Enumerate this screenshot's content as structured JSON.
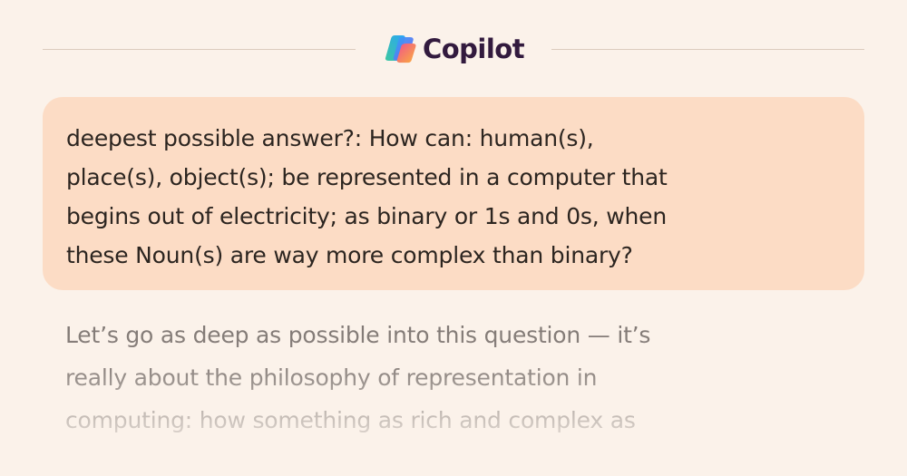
{
  "header": {
    "brand_name": "Copilot",
    "logo_icon": "copilot-logo-icon",
    "colors": {
      "brand_text": "#321a3e",
      "logo_gradient": [
        "#2ba5f7",
        "#7b5cf2",
        "#f0508f",
        "#fbb03b"
      ]
    }
  },
  "user_message": {
    "lines": [
      "deepest possible answer?: How can: human(s),",
      "place(s), object(s); be represented in a computer that",
      "begins out of electricity; as binary or 1s and 0s, when",
      "these Noun(s) are way more complex than binary?"
    ],
    "bubble_color": "#fcdcc5"
  },
  "assistant_message": {
    "lines": [
      " Let’s go as deep as possible into this question — it’s",
      "really about the philosophy of representation in",
      "computing: how something as rich and complex as"
    ]
  },
  "colors": {
    "background": "#fbf2ea"
  }
}
